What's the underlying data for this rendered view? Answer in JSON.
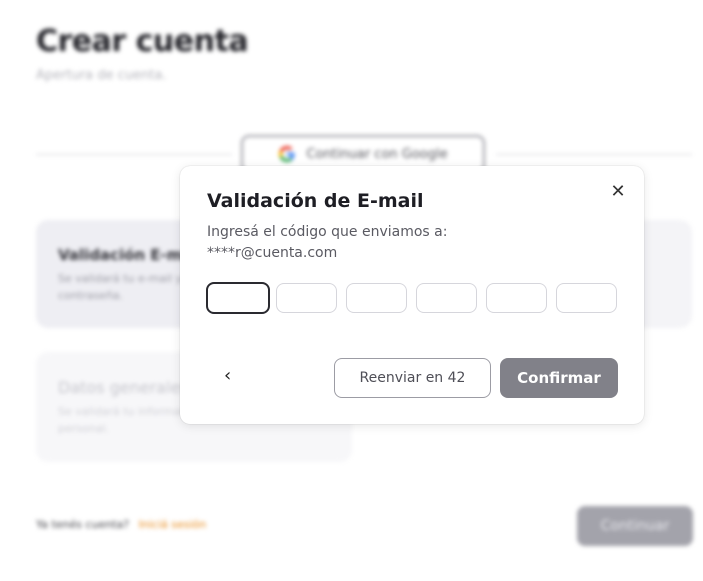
{
  "page": {
    "title": "Crear cuenta",
    "subtitle": "Apertura de cuenta.",
    "google_button_label": "Continuar con Google",
    "steps": [
      {
        "title": "Validación E-mail",
        "description": "Se validará tu e-mail y contraseña."
      },
      {
        "title": "Datos generales",
        "description": "Se validará tu información personal."
      }
    ],
    "footer": {
      "question": "Ya tenés cuenta?",
      "login_link": "Iniciá sesión"
    },
    "continue_label": "Continuar"
  },
  "modal": {
    "title": "Validación de E-mail",
    "description_line1": "Ingresá el código que enviamos a:",
    "email": "****r@cuenta.com",
    "code_digits": [
      "",
      "",
      "",
      "",
      "",
      ""
    ],
    "back_icon": "chevron-left-icon",
    "close_icon": "close-icon",
    "resend_label": "Reenviar en 42",
    "confirm_label": "Confirmar"
  },
  "colors": {
    "accent_link": "#e88a1a",
    "confirm_button": "#818189",
    "disabled_button": "#a3a3ab"
  }
}
